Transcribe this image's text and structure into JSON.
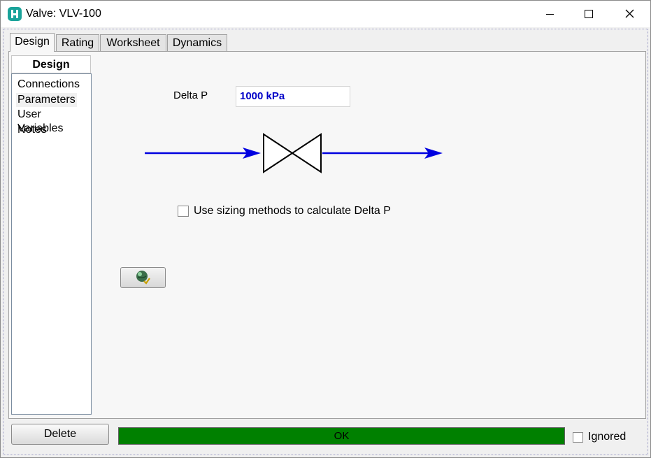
{
  "window": {
    "title": "Valve: VLV-100",
    "controls": {
      "minimize": "minimize",
      "maximize": "maximize",
      "close": "close"
    }
  },
  "tabs": [
    {
      "label": "Design",
      "active": true
    },
    {
      "label": "Rating",
      "active": false
    },
    {
      "label": "Worksheet",
      "active": false
    },
    {
      "label": "Dynamics",
      "active": false
    }
  ],
  "sidebar": {
    "header": "Design",
    "items": [
      {
        "label": "Connections",
        "selected": false
      },
      {
        "label": "Parameters",
        "selected": true
      },
      {
        "label": "User Variables",
        "selected": false
      },
      {
        "label": "Notes",
        "selected": false
      }
    ]
  },
  "parameters": {
    "delta_p_label": "Delta P",
    "delta_p_value": "1000 kPa",
    "sizing_checkbox_label": "Use sizing methods to calculate Delta P",
    "sizing_checked": false
  },
  "footer": {
    "delete_label": "Delete",
    "status_text": "OK",
    "ignored_label": "Ignored",
    "ignored_checked": false
  },
  "colors": {
    "stream_arrow": "#0000e0",
    "status_ok": "#008000",
    "value_text": "#0000c8",
    "app_icon": "#1aa39a"
  },
  "icons": [
    "app-logo-icon",
    "valve-icon",
    "globe-check-icon"
  ]
}
